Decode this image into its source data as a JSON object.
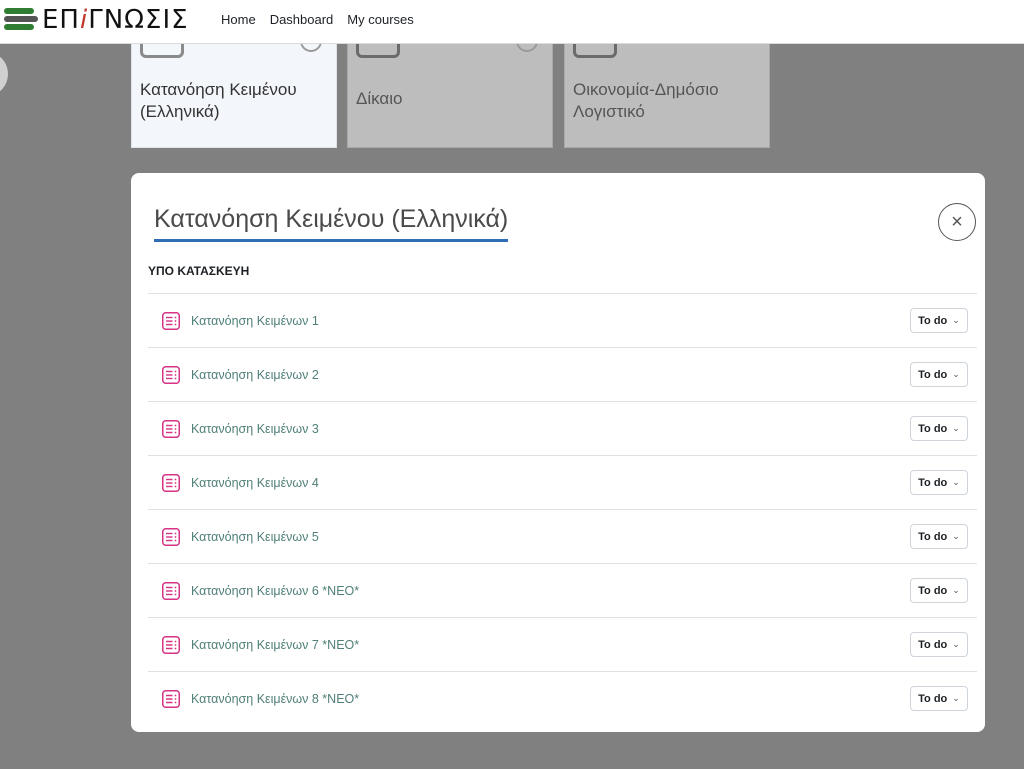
{
  "brand": {
    "logo_pre": "ΕΠ",
    "logo_i": "i",
    "logo_post": "ΓΝΩΣΙΣ"
  },
  "nav": [
    "Home",
    "Dashboard",
    "My courses"
  ],
  "courses": [
    {
      "title": "Κατανόηση Κειμένου (Ελληνικά)"
    },
    {
      "title": "Δίκαιο"
    },
    {
      "title": "Οικονομία-Δημόσιο Λογιστικό"
    }
  ],
  "modal": {
    "title": "Κατανόηση Κειμένου (Ελληνικά)",
    "close_glyph": "×",
    "section": "ΥΠΟ ΚΑΤΑΣΚΕΥΗ",
    "activities": [
      {
        "name": "Κατανόηση Κειμένων 1",
        "status": "To do"
      },
      {
        "name": "Κατανόηση Κειμένων 2",
        "status": "To do"
      },
      {
        "name": "Κατανόηση Κειμένων 3",
        "status": "To do"
      },
      {
        "name": "Κατανόηση Κειμένων 4",
        "status": "To do"
      },
      {
        "name": "Κατανόηση Κειμένων 5",
        "status": "To do"
      },
      {
        "name": "Κατανόηση Κειμένων 6 *ΝΕΟ*",
        "status": "To do"
      },
      {
        "name": "Κατανόηση Κειμένων 7 *ΝΕΟ*",
        "status": "To do"
      },
      {
        "name": "Κατανόηση Κειμένων 8 *ΝΕΟ*",
        "status": "To do"
      }
    ]
  },
  "icons": {
    "activity": "quiz-list-icon",
    "close": "close-icon",
    "dropdown": "chevron-down-icon"
  },
  "colors": {
    "accent": "#2f6db5",
    "activity_icon": "#d63384",
    "link": "#4f7f78",
    "overlay": "#808080"
  }
}
